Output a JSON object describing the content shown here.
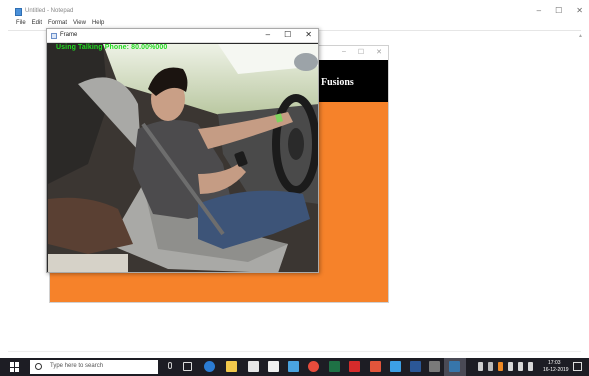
{
  "notepad": {
    "title": "Untitled - Notepad",
    "menu": [
      "File",
      "Edit",
      "Format",
      "View",
      "Help"
    ],
    "controls": {
      "minimize": "–",
      "maximize": "☐",
      "close": "✕"
    }
  },
  "back_window": {
    "header_text": "Fusions",
    "controls": {
      "minimize": "–",
      "maximize": "☐",
      "close": "✕"
    },
    "colors": {
      "body": "#f6822a",
      "header": "#000000"
    }
  },
  "frame_window": {
    "title": "Frame",
    "controls": {
      "minimize": "–",
      "maximize": "☐",
      "close": "✕"
    },
    "overlay_text": "Using Talking Phone: 80.00%000",
    "overlay_color": "#22dd22"
  },
  "taskbar": {
    "search_placeholder": "Type here to search",
    "clock_time": "17:03",
    "clock_date": "16-12-2019",
    "apps": [
      "task-view-icon",
      "edge-icon",
      "file-explorer-icon",
      "store-icon",
      "mail-icon",
      "photos-icon",
      "chrome-icon",
      "excel-icon",
      "acrobat-icon",
      "paint-icon",
      "notepad-icon",
      "word-icon",
      "media-icon",
      "python-icon"
    ]
  }
}
